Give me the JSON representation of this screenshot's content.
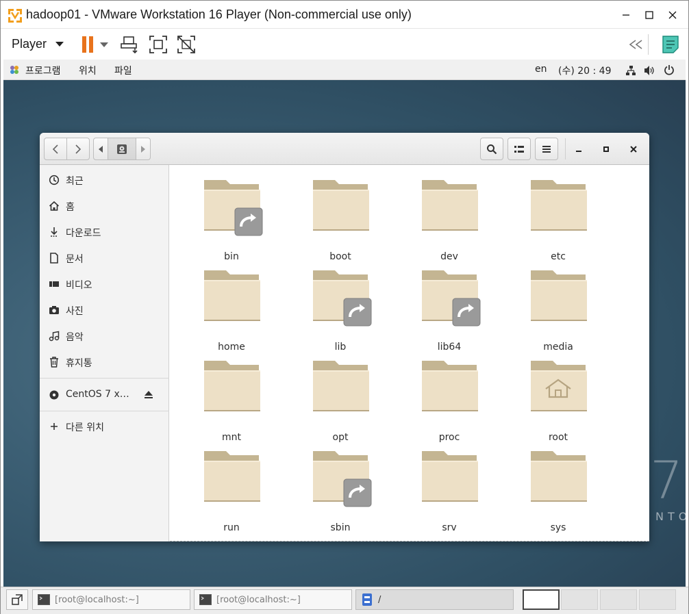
{
  "vm": {
    "title": "hadoop01 - VMware Workstation 16 Player (Non-commercial use only)",
    "player_label": "Player",
    "accent_pause": "#e8731c"
  },
  "gnome": {
    "apps_label": "프로그램",
    "places_label": "위치",
    "files_label": "파일",
    "lang": "en",
    "clock": "(수) 20 : 49"
  },
  "sidebar": {
    "items": [
      {
        "label": "최근",
        "icon": "clock-icon"
      },
      {
        "label": "홈",
        "icon": "home-icon"
      },
      {
        "label": "다운로드",
        "icon": "download-icon"
      },
      {
        "label": "문서",
        "icon": "document-icon"
      },
      {
        "label": "비디오",
        "icon": "video-icon"
      },
      {
        "label": "사진",
        "icon": "camera-icon"
      },
      {
        "label": "음악",
        "icon": "music-icon"
      },
      {
        "label": "휴지통",
        "icon": "trash-icon"
      }
    ],
    "device": {
      "label": "CentOS 7 x…",
      "icon": "disc-icon"
    },
    "other": {
      "label": "다른 위치",
      "icon": "plus-icon"
    }
  },
  "folders": [
    {
      "name": "bin",
      "link": true
    },
    {
      "name": "boot",
      "link": false
    },
    {
      "name": "dev",
      "link": false
    },
    {
      "name": "etc",
      "link": false
    },
    {
      "name": "home",
      "link": false
    },
    {
      "name": "lib",
      "link": true
    },
    {
      "name": "lib64",
      "link": true
    },
    {
      "name": "media",
      "link": false
    },
    {
      "name": "mnt",
      "link": false
    },
    {
      "name": "opt",
      "link": false
    },
    {
      "name": "proc",
      "link": false
    },
    {
      "name": "root",
      "link": false,
      "home_emblem": true
    },
    {
      "name": "run",
      "link": false
    },
    {
      "name": "sbin",
      "link": true
    },
    {
      "name": "srv",
      "link": false
    },
    {
      "name": "sys",
      "link": false
    }
  ],
  "taskbar": {
    "tasks": [
      "[root@localhost:~]",
      "[root@localhost:~]",
      "/"
    ]
  },
  "desktop": {
    "seven": "7",
    "nto": "NTO"
  }
}
